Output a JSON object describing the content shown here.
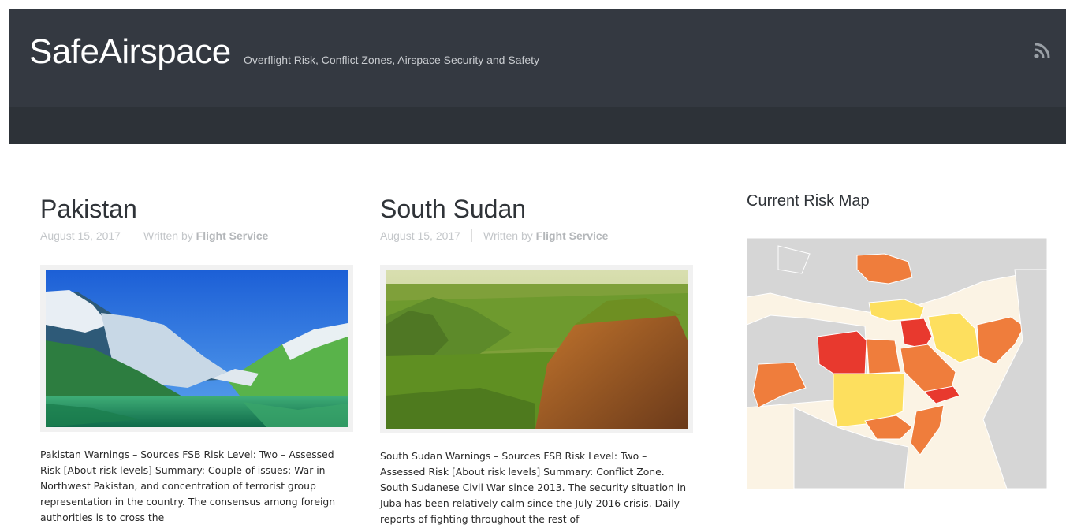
{
  "site": {
    "title": "SafeAirspace",
    "tagline": "Overflight Risk, Conflict Zones, Airspace Security and Safety",
    "rss_icon": "rss-icon"
  },
  "posts": [
    {
      "title": "Pakistan",
      "date": "August 15, 2017",
      "written_by": "Written by",
      "author": "Flight Service",
      "image": "mountain-lake-image",
      "excerpt": "Pakistan Warnings – Sources FSB Risk Level: Two – Assessed Risk [About risk levels]   Summary: Couple of issues: War in Northwest Pakistan, and concentration of terrorist group representation in the country. The consensus among foreign authorities is to cross the"
    },
    {
      "title": "South Sudan",
      "date": "August 15, 2017",
      "written_by": "Written by",
      "author": "Flight Service",
      "image": "green-landscape-image",
      "excerpt": "South Sudan Warnings – Sources FSB Risk Level: Two – Assessed Risk [About risk levels]   Summary: Conflict Zone. South Sudanese Civil War since 2013. The security situation in Juba has been relatively calm since the July 2016 crisis. Daily reports of fighting throughout the rest of"
    }
  ],
  "sidebar": {
    "widget_title": "Current Risk Map",
    "risk_colors": {
      "high": "#e8392e",
      "elevated": "#ef7d3c",
      "caution": "#fddf5e",
      "land": "#d6d6d6",
      "water": "#fbf3e4"
    }
  }
}
